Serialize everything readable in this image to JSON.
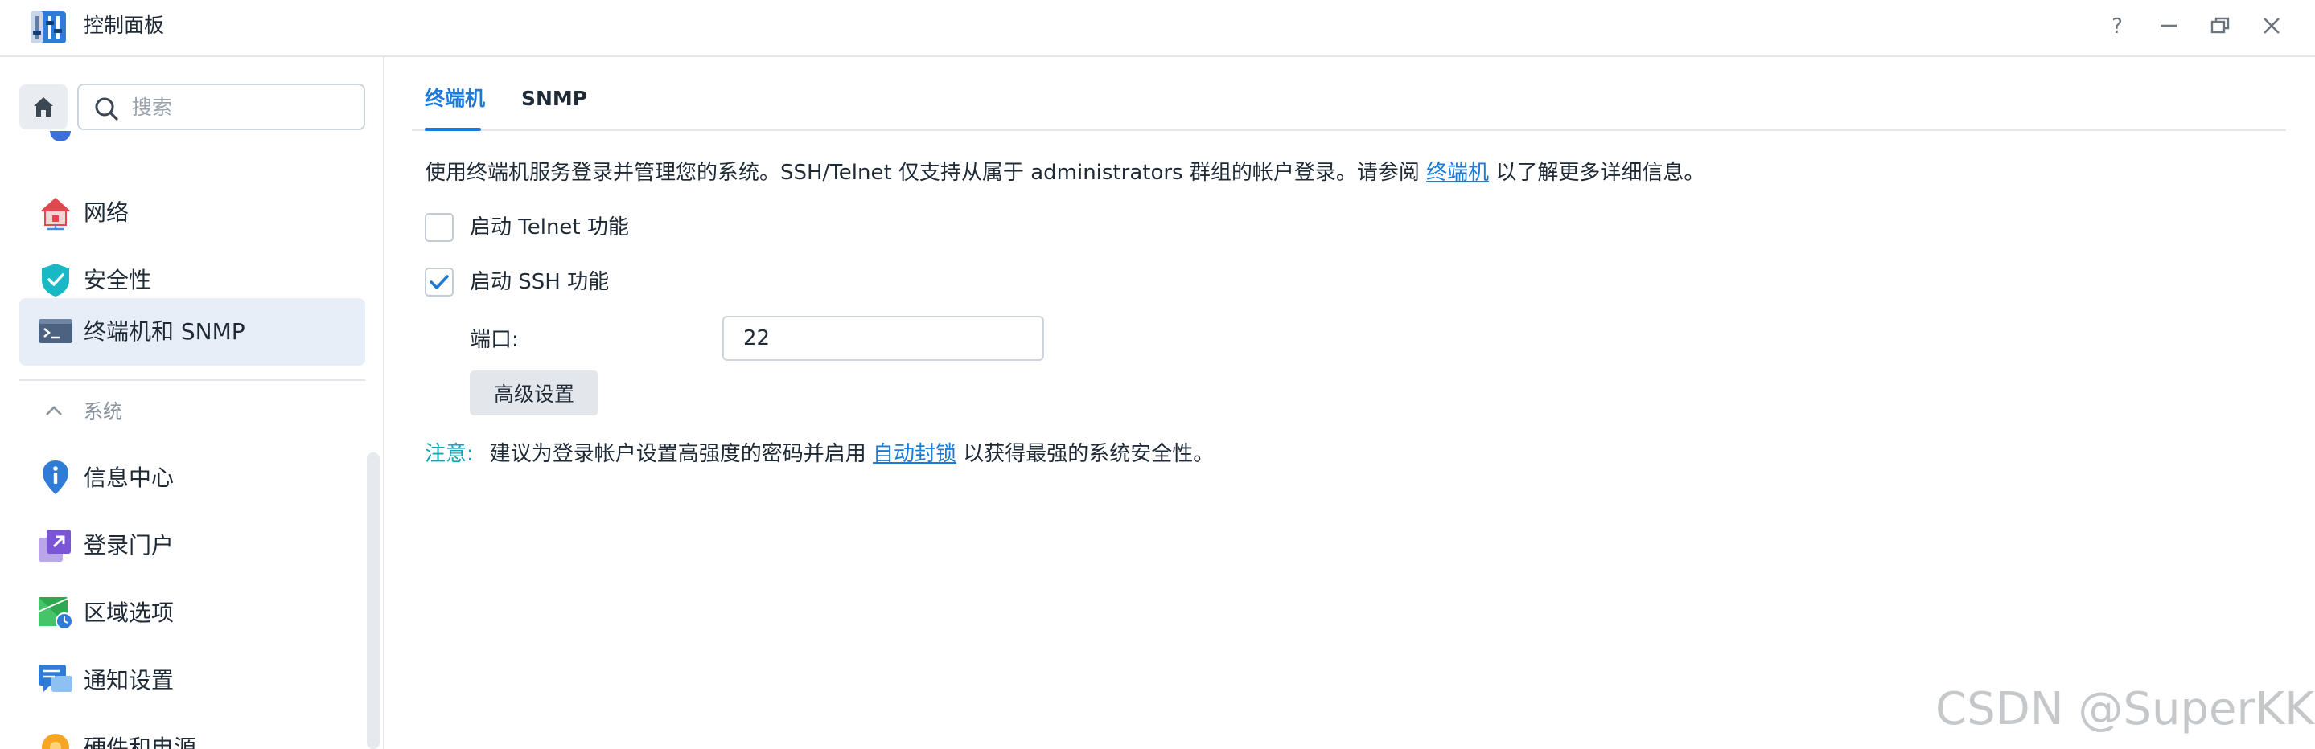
{
  "window": {
    "title": "控制面板",
    "controls": [
      "help-icon",
      "minimize-icon",
      "restore-icon",
      "close-icon"
    ]
  },
  "sidebar": {
    "search_placeholder": "搜索",
    "items": [
      {
        "label": "网络",
        "icon": "network-house-icon",
        "active": false
      },
      {
        "label": "安全性",
        "icon": "shield-check-icon",
        "active": false
      },
      {
        "label": "终端机和 SNMP",
        "icon": "terminal-icon",
        "active": true
      }
    ],
    "section": {
      "label": "系统",
      "expanded": true
    },
    "system_items": [
      {
        "label": "信息中心",
        "icon": "info-pin-icon"
      },
      {
        "label": "登录门户",
        "icon": "login-portal-icon"
      },
      {
        "label": "区域选项",
        "icon": "region-map-clock-icon"
      },
      {
        "label": "通知设置",
        "icon": "notification-chat-icon"
      },
      {
        "label": "硬件和电源",
        "icon": "hardware-power-icon"
      }
    ]
  },
  "tabs": [
    {
      "label": "终端机",
      "active": true
    },
    {
      "label": "SNMP",
      "active": false
    }
  ],
  "terminal": {
    "description_before": "使用终端机服务登录并管理您的系统。SSH/Telnet 仅支持从属于 administrators 群组的帐户登录。请参阅 ",
    "description_link": "终端机",
    "description_after": " 以了解更多详细信息。",
    "telnet_label": "启动 Telnet 功能",
    "telnet_checked": false,
    "ssh_label": "启动 SSH 功能",
    "ssh_checked": true,
    "port_label": "端口:",
    "port_value": "22",
    "advanced_button": "高级设置",
    "note_label": "注意:",
    "note_before": "建议为登录帐户设置高强度的密码并启用 ",
    "note_link": "自动封锁",
    "note_after": " 以获得最强的系统安全性。"
  },
  "colors": {
    "accent": "#1d7ad6",
    "note": "#12a5b3",
    "active_bg": "#e7eef8"
  },
  "watermark": "CSDN @SuperKKig"
}
